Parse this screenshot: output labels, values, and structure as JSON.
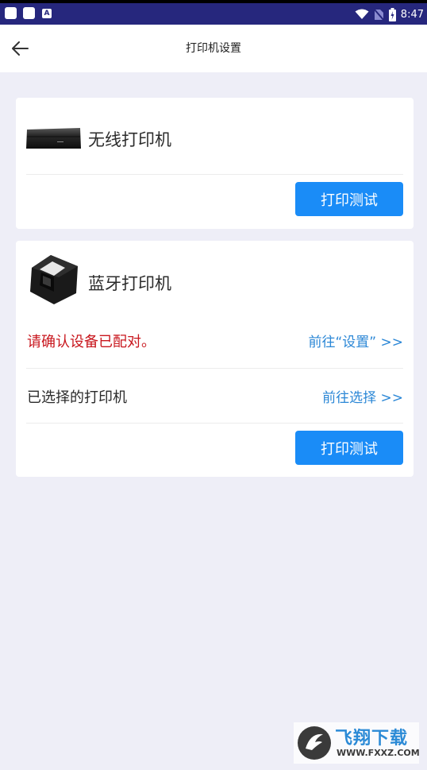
{
  "status_bar": {
    "time": "8:47",
    "left_badge": "A",
    "icons": [
      "app-notification-icon",
      "app-notification-icon",
      "a-badge-icon",
      "wifi-icon",
      "no-sim-icon",
      "battery-charging-icon"
    ]
  },
  "header": {
    "title": "打印机设置",
    "back_icon": "arrow-left-icon"
  },
  "wireless_printer": {
    "name": "无线打印机",
    "print_test_label": "打印测试"
  },
  "bluetooth_printer": {
    "name": "蓝牙打印机",
    "confirm_pair_text": "请确认设备已配对。",
    "goto_settings_link": "前往“设置” >>",
    "selected_printer_label": "已选择的打印机",
    "goto_select_link": "前往选择 >>",
    "print_test_label": "打印测试"
  },
  "colors": {
    "accent": "#1a8cf7",
    "link": "#2b87d6",
    "warning": "#c8161d",
    "status_bar": "#26277d",
    "background": "#eeeef7"
  },
  "watermark": {
    "title": "飞翔下载",
    "url": "WWW.FXXZ.COM"
  }
}
